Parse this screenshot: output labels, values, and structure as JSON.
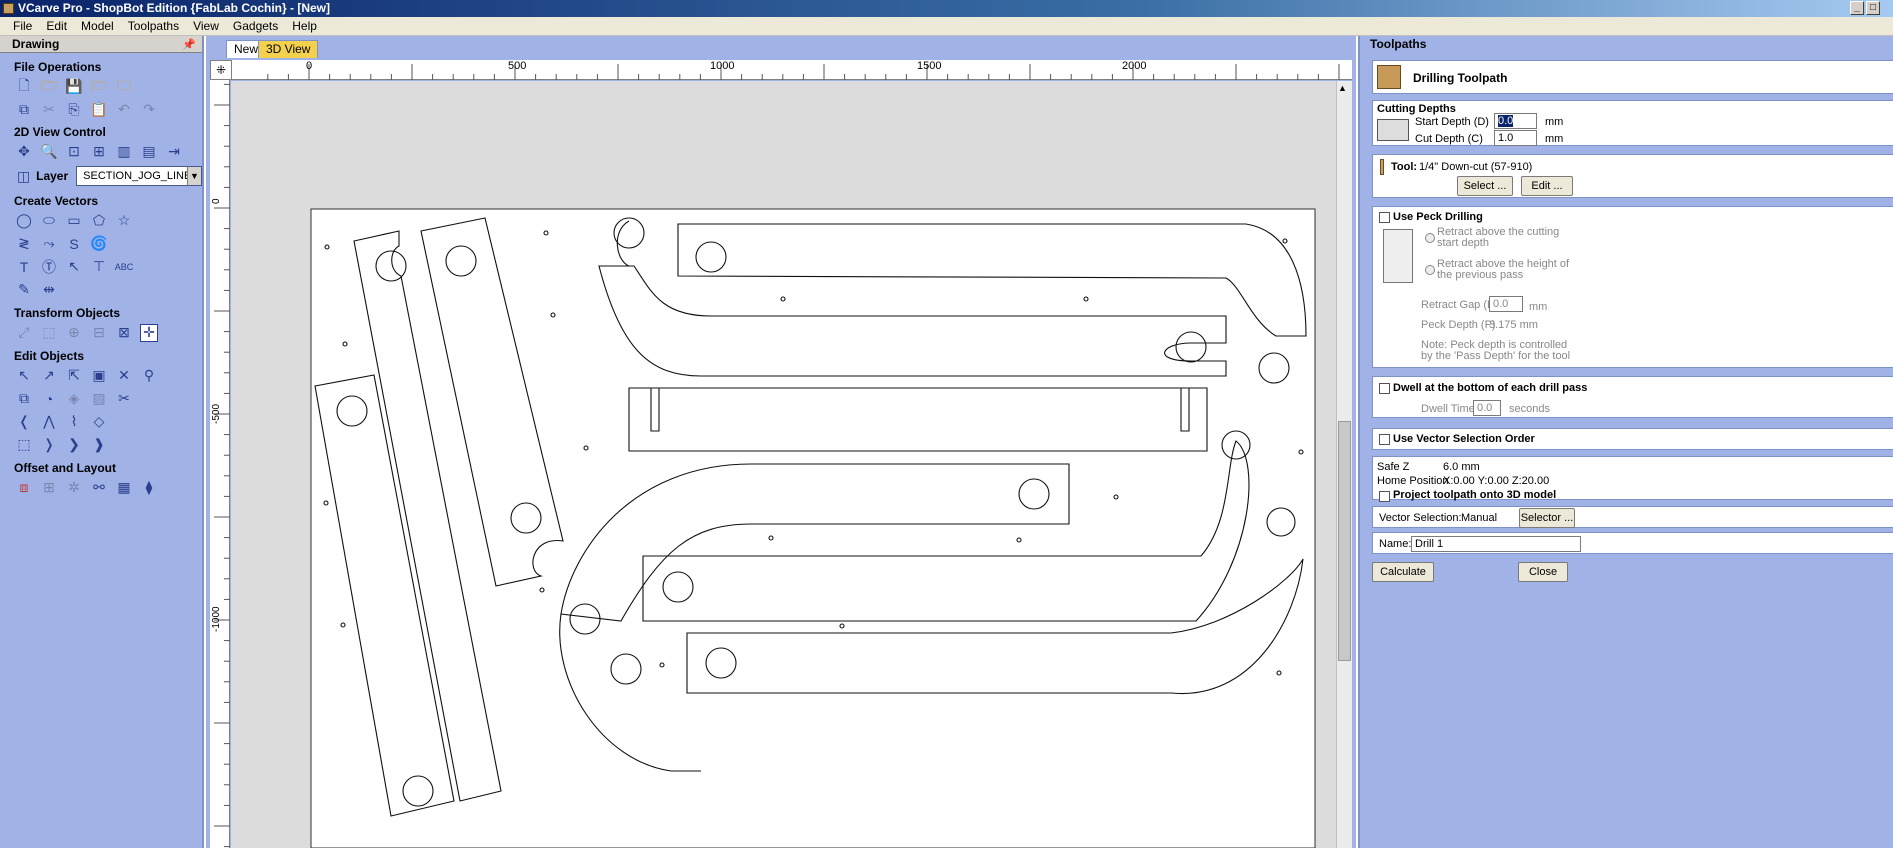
{
  "window": {
    "title": "VCarve Pro - ShopBot Edition {FabLab Cochin} - [New]"
  },
  "menu": [
    "File",
    "Edit",
    "Model",
    "Toolpaths",
    "View",
    "Gadgets",
    "Help"
  ],
  "left_panel": {
    "title": "Drawing",
    "sections": {
      "file_operations": "File Operations",
      "view_control": "2D View Control",
      "create_vectors": "Create Vectors",
      "transform_objects": "Transform Objects",
      "edit_objects": "Edit Objects",
      "offset_layout": "Offset and Layout"
    },
    "layer_label": "Layer",
    "layer_value": "SECTION_JOG_LINES"
  },
  "tabs": [
    {
      "label": "New",
      "active": true
    },
    {
      "label": "3D View",
      "active": false
    }
  ],
  "rulers": {
    "top_ticks": [
      "0",
      "500",
      "1000",
      "1500",
      "2000"
    ],
    "left_ticks": [
      "0",
      "-500",
      "-1000"
    ]
  },
  "right_panel": {
    "title": "Toolpaths",
    "toolpath_name": "Drilling Toolpath",
    "cutting_depths": {
      "heading": "Cutting Depths",
      "start_depth_label": "Start Depth (D)",
      "start_depth_value": "0.0",
      "cut_depth_label": "Cut Depth (C)",
      "cut_depth_value": "1.0",
      "unit": "mm"
    },
    "tool": {
      "label": "Tool:",
      "value": "1/4\"  Down-cut (57-910)",
      "select_button": "Select ...",
      "edit_button": "Edit ..."
    },
    "peck": {
      "checkbox_label": "Use Peck Drilling",
      "option1": "Retract above the cutting start depth",
      "option2": "Retract above the height of the previous pass",
      "retract_gap_label": "Retract Gap (R)",
      "retract_gap_value": "0.0",
      "retract_gap_unit": "mm",
      "peck_depth_label": "Peck Depth (P)",
      "peck_depth_value": "3.175 mm",
      "note": "Note: Peck depth is controlled by the 'Pass Depth' for the tool"
    },
    "dwell": {
      "checkbox_label": "Dwell at the bottom of each drill pass",
      "time_label": "Dwell Time",
      "time_value": "0.0",
      "time_unit": "seconds"
    },
    "vector_order": {
      "checkbox_label": "Use Vector Selection Order"
    },
    "safe_z_label": "Safe Z",
    "safe_z_value": "6.0 mm",
    "home_label": "Home Position",
    "home_value": "X:0.00 Y:0.00 Z:20.00",
    "project_label": "Project toolpath onto 3D model",
    "vector_selection_label": "Vector Selection:",
    "vector_selection_value": "Manual",
    "selector_button": "Selector ...",
    "name_label": "Name:",
    "name_value": "Drill 1",
    "calculate_button": "Calculate",
    "close_button": "Close"
  },
  "colors": {
    "panel_bg": "#a0b2e6",
    "canvas_bg": "#dcdcdc",
    "tab_inactive": "#f4d14c"
  }
}
